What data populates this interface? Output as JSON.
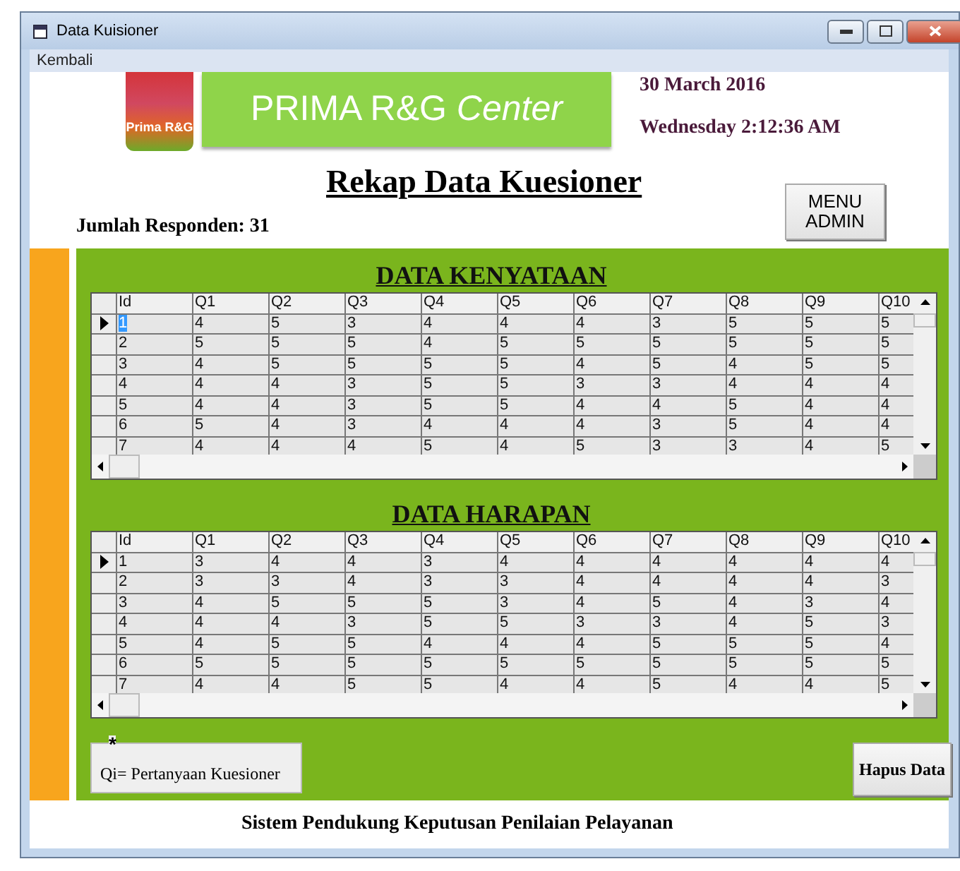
{
  "window": {
    "title": "Data Kuisioner"
  },
  "menu": [
    "Kembali"
  ],
  "header": {
    "logo_text": "Prima R&G",
    "banner": "PRIMA R&G *Center*",
    "date": "30 March 2016",
    "time": "Wednesday 2:12:36 AM"
  },
  "title": "Rekap Data Kuesioner",
  "respondents": "Jumlah Responden: 31",
  "menu_button": "MENU ADMIN",
  "grids": [
    {
      "heading": "DATA KENYATAAN",
      "columns": [
        "Id",
        "Q1",
        "Q2",
        "Q3",
        "Q4",
        "Q5",
        "Q6",
        "Q7",
        "Q8",
        "Q9",
        "Q10"
      ],
      "rows": [
        {
          "current": true,
          "selected": true,
          "cells": [
            "1",
            "4",
            "5",
            "3",
            "4",
            "4",
            "4",
            "3",
            "5",
            "5",
            "5"
          ]
        },
        {
          "current": false,
          "selected": false,
          "cells": [
            "2",
            "5",
            "5",
            "5",
            "4",
            "5",
            "5",
            "5",
            "5",
            "5",
            "5"
          ]
        },
        {
          "current": false,
          "selected": false,
          "cells": [
            "3",
            "4",
            "5",
            "5",
            "5",
            "5",
            "4",
            "5",
            "4",
            "5",
            "5"
          ]
        },
        {
          "current": false,
          "selected": false,
          "cells": [
            "4",
            "4",
            "4",
            "3",
            "5",
            "5",
            "3",
            "3",
            "4",
            "4",
            "4"
          ]
        },
        {
          "current": false,
          "selected": false,
          "cells": [
            "5",
            "4",
            "4",
            "3",
            "5",
            "5",
            "4",
            "4",
            "5",
            "4",
            "4"
          ]
        },
        {
          "current": false,
          "selected": false,
          "cells": [
            "6",
            "5",
            "4",
            "3",
            "4",
            "4",
            "4",
            "3",
            "5",
            "4",
            "4"
          ]
        },
        {
          "current": false,
          "selected": false,
          "cells": [
            "7",
            "4",
            "4",
            "4",
            "5",
            "4",
            "5",
            "3",
            "3",
            "4",
            "5"
          ]
        }
      ]
    },
    {
      "heading": "DATA HARAPAN",
      "columns": [
        "Id",
        "Q1",
        "Q2",
        "Q3",
        "Q4",
        "Q5",
        "Q6",
        "Q7",
        "Q8",
        "Q9",
        "Q10"
      ],
      "rows": [
        {
          "current": true,
          "selected": false,
          "cells": [
            "1",
            "3",
            "4",
            "4",
            "3",
            "4",
            "4",
            "4",
            "4",
            "4",
            "4"
          ]
        },
        {
          "current": false,
          "selected": false,
          "cells": [
            "2",
            "3",
            "3",
            "4",
            "3",
            "3",
            "4",
            "4",
            "4",
            "4",
            "3"
          ]
        },
        {
          "current": false,
          "selected": false,
          "cells": [
            "3",
            "4",
            "5",
            "5",
            "5",
            "3",
            "4",
            "5",
            "4",
            "3",
            "4"
          ]
        },
        {
          "current": false,
          "selected": false,
          "cells": [
            "4",
            "4",
            "4",
            "3",
            "5",
            "5",
            "3",
            "3",
            "4",
            "5",
            "3"
          ]
        },
        {
          "current": false,
          "selected": false,
          "cells": [
            "5",
            "4",
            "5",
            "5",
            "4",
            "4",
            "4",
            "5",
            "5",
            "5",
            "4"
          ]
        },
        {
          "current": false,
          "selected": false,
          "cells": [
            "6",
            "5",
            "5",
            "5",
            "5",
            "5",
            "5",
            "5",
            "5",
            "5",
            "5"
          ]
        },
        {
          "current": false,
          "selected": false,
          "cells": [
            "7",
            "4",
            "4",
            "5",
            "5",
            "4",
            "4",
            "5",
            "4",
            "4",
            "5"
          ]
        }
      ]
    }
  ],
  "legend": {
    "title": "*",
    "text": "Qi= Pertanyaan Kuesioner"
  },
  "delete_button": "Hapus Data",
  "footer": "Sistem Pendukung Keputusan Penilaian Pelayanan"
}
